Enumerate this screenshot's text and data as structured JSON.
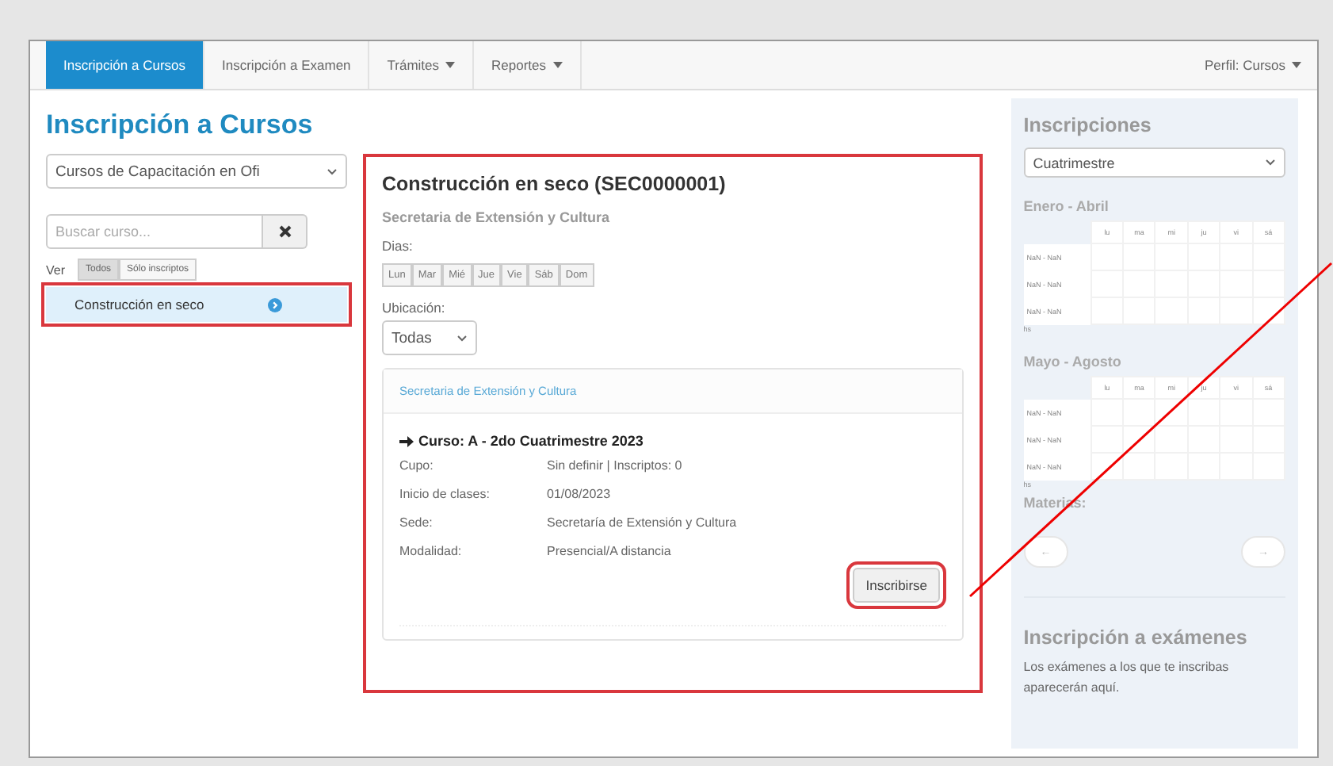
{
  "navbar": {
    "tabs": [
      {
        "label": "Inscripción a Cursos",
        "selected": true,
        "dropdown": false
      },
      {
        "label": "Inscripción a Examen",
        "selected": false,
        "dropdown": false
      },
      {
        "label": "Trámites",
        "selected": false,
        "dropdown": true
      },
      {
        "label": "Reportes",
        "selected": false,
        "dropdown": true
      }
    ],
    "profile": "Perfil: Cursos"
  },
  "page_title": "Inscripción a Cursos",
  "left": {
    "category_select": "Cursos de Capacitación en Ofi",
    "search": {
      "placeholder": "Buscar curso..."
    },
    "filter_label": "Ver",
    "filters": [
      {
        "label": "Todos",
        "selected": true
      },
      {
        "label": "Sólo inscriptos",
        "selected": false
      }
    ],
    "courses": [
      {
        "label": "Construcción en seco",
        "selected": true
      }
    ]
  },
  "course": {
    "title": "Construcción en seco (SEC0000001)",
    "subtitle": "Secretaria de Extensión y Cultura",
    "days_label": "Dias:",
    "days": [
      "Lun",
      "Mar",
      "Mié",
      "Jue",
      "Vie",
      "Sáb",
      "Dom"
    ],
    "location_label": "Ubicación:",
    "location_select": "Todas",
    "panel": {
      "heading": "Secretaria de Extensión y Cultura",
      "course_title": "Curso: A - 2do Cuatrimestre 2023",
      "details": [
        {
          "label": "Cupo:",
          "value": "Sin definir | Inscriptos: 0"
        },
        {
          "label": "Inicio de clases:",
          "value": "01/08/2023"
        },
        {
          "label": "Sede:",
          "value": "Secretaría de Extensión y Cultura"
        },
        {
          "label": "Modalidad:",
          "value": "Presencial/A distancia"
        }
      ],
      "button": "Inscribirse"
    }
  },
  "sidebar": {
    "title": "Inscripciones",
    "period_select": "Cuatrimestre",
    "calendars": [
      {
        "title": "Enero - Abril",
        "days": [
          "lu",
          "ma",
          "mi",
          "ju",
          "vi",
          "sá"
        ],
        "rows": [
          "NaN - NaN",
          "NaN - NaN",
          "NaN - NaN"
        ],
        "unit": "hs"
      },
      {
        "title": "Mayo - Agosto",
        "days": [
          "lu",
          "ma",
          "mi",
          "ju",
          "vi",
          "sá"
        ],
        "rows": [
          "NaN - NaN",
          "NaN - NaN",
          "NaN - NaN"
        ],
        "unit": "hs"
      }
    ],
    "subjects_label": "Materias:",
    "prev": "←",
    "next": "→",
    "exams_title": "Inscripción a exámenes",
    "exams_text": "Los exámenes a los que te inscribas aparecerán aquí."
  }
}
